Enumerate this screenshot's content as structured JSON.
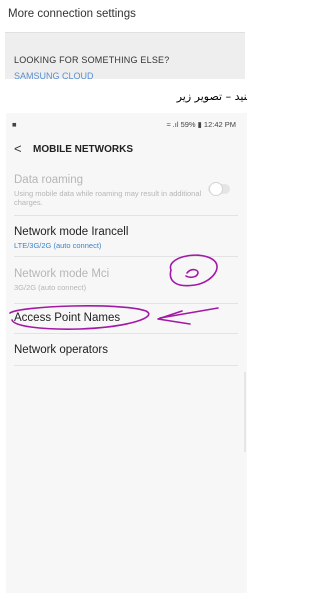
{
  "top": {
    "more_connection": "More connection settings",
    "card_title": "LOOKING FOR SOMETHING ELSE?",
    "card_link": "SAMSUNG CLOUD"
  },
  "caption_rtl": "ﻨﯿﺪ – ﺗﺼﻮﯾﺮ زﯾﺮ",
  "status": {
    "left": "■",
    "right": "≈ .ıl 59% ▮ 12:42 PM"
  },
  "header": {
    "back": "<",
    "title": "MOBILE NETWORKS"
  },
  "items": [
    {
      "title": "Data roaming",
      "subtitle": "Using mobile data while roaming may result in additional charges.",
      "state": "disabled",
      "toggle": false
    },
    {
      "title": "Network mode Irancell",
      "subtitle": "LTE/3G/2G (auto connect)",
      "state": "enabled"
    },
    {
      "title": "Network mode Mci",
      "subtitle": "3G/2G (auto connect)",
      "state": "disabled"
    },
    {
      "title": "Access Point Names",
      "state": "enabled",
      "annotated": true
    },
    {
      "title": "Network operators",
      "state": "enabled"
    }
  ],
  "colors": {
    "accent": "#3d83c7",
    "annotation": "#a318a6",
    "disabled": "#b6b6b6"
  }
}
